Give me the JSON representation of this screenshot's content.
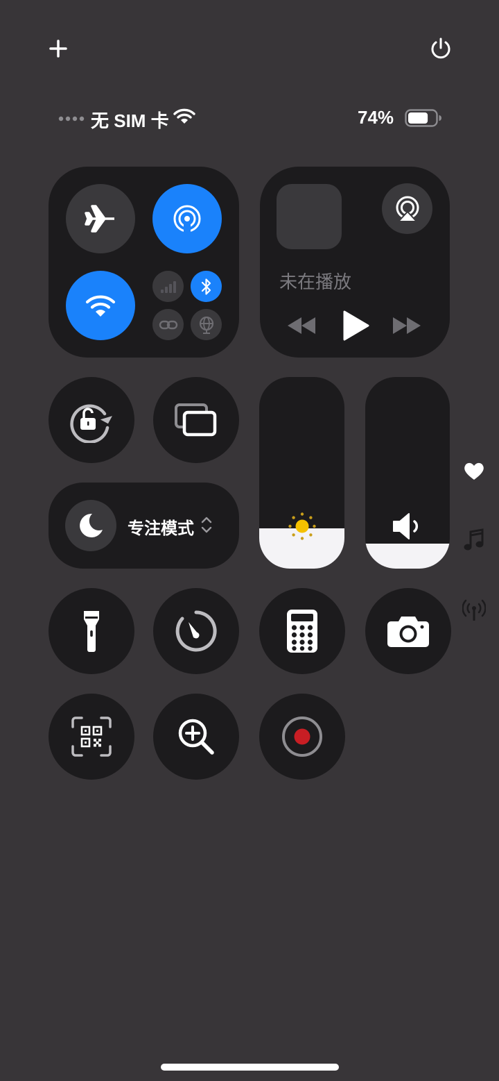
{
  "status_bar": {
    "carrier": "无 SIM 卡",
    "battery_percent": "74%",
    "battery_level": 0.74
  },
  "connectivity": {
    "airplane_mode": false,
    "airdrop": true,
    "wifi": true,
    "cellular": false,
    "bluetooth": true,
    "personal_hotspot": false,
    "vpn": false
  },
  "media": {
    "now_playing": "未在播放"
  },
  "focus": {
    "label": "专注模式"
  },
  "sliders": {
    "brightness_level": 0.21,
    "volume_level": 0.13
  },
  "colors": {
    "background": "#383538",
    "tile": "#1c1b1d",
    "accent_blue": "#1a82fb",
    "record_red": "#c81e24",
    "sun_yellow": "#f5c100"
  },
  "icons": {
    "add": "plus-icon",
    "power": "power-icon",
    "side": [
      "heart-icon",
      "music-note-icon",
      "broadcast-icon"
    ]
  }
}
